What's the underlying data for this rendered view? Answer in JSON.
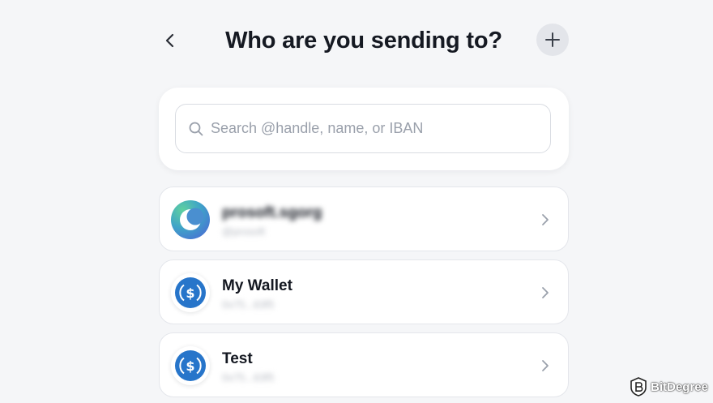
{
  "header": {
    "title": "Who are you sending to?",
    "back_icon": "chevron-left-icon",
    "add_icon": "plus-icon"
  },
  "search": {
    "placeholder": "Search @handle, name, or IBAN",
    "value": "",
    "icon": "search-icon"
  },
  "recipients": [
    {
      "name": "prosoft.sgorg",
      "sub": "@prosoft",
      "avatar": "gradient-avatar",
      "blurred": true
    },
    {
      "name": "My Wallet",
      "sub": "0x75...63f5",
      "avatar": "usdc-icon",
      "blurred": false
    },
    {
      "name": "Test",
      "sub": "0x75...63f5",
      "avatar": "usdc-icon",
      "blurred": false
    }
  ],
  "watermark": {
    "brand": "BitDegree"
  },
  "colors": {
    "background": "#f5f6f8",
    "usdc_blue": "#2775ca",
    "text_primary": "#141821",
    "placeholder": "#9aa0ab"
  }
}
